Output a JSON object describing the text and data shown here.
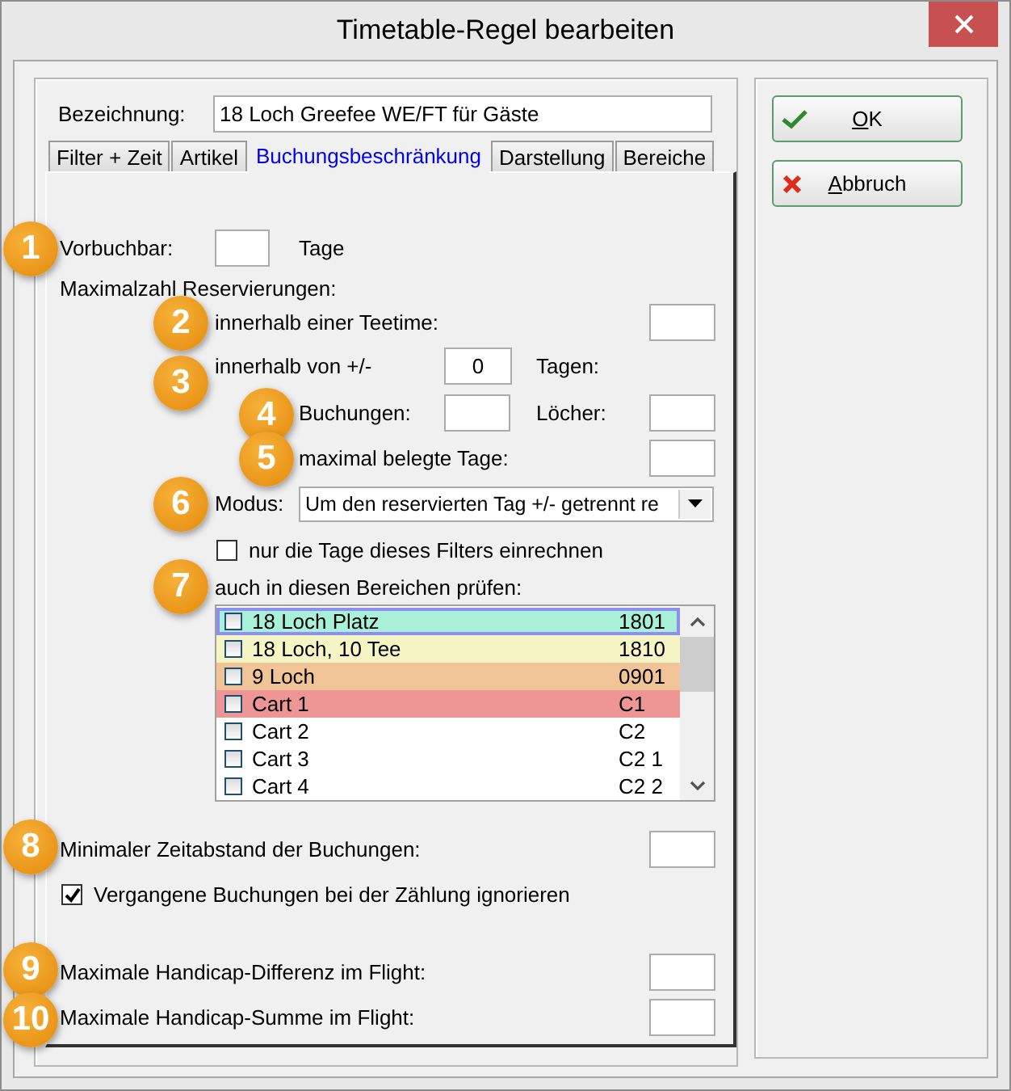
{
  "window": {
    "title": "Timetable-Regel bearbeiten"
  },
  "name_field": {
    "label": "Bezeichnung:",
    "value": "18 Loch Greefee WE/FT für Gäste"
  },
  "tabs": [
    {
      "label": "Filter + Zeit",
      "selected": false
    },
    {
      "label": "Artikel",
      "selected": false
    },
    {
      "label": "Buchungsbeschränkung",
      "selected": true
    },
    {
      "label": "Darstellung",
      "selected": false
    },
    {
      "label": "Bereiche",
      "selected": false
    }
  ],
  "advance_booking": {
    "callout": "1",
    "label": "Vorbuchbar:",
    "unit": "Tage"
  },
  "max_reservations": {
    "heading": "Maximalzahl Reservierungen:",
    "per_teetime": {
      "callout": "2",
      "label": "innerhalb einer Teetime:"
    },
    "range": {
      "callout": "3",
      "label": "innerhalb von +/-",
      "value": "0",
      "unit": "Tagen:"
    },
    "bookings": {
      "callout": "4",
      "label": "Buchungen:",
      "holes_label": "Löcher:"
    },
    "max_days": {
      "callout": "5",
      "label": "maximal belegte Tage:"
    },
    "mode": {
      "callout": "6",
      "label": "Modus:",
      "value": "Um den reservierten Tag +/- getrennt re"
    },
    "filter_days_only": {
      "label": "nur die Tage dieses Filters einrechnen",
      "checked": false
    },
    "areas": {
      "callout": "7",
      "label": "auch in diesen Bereichen prüfen:",
      "items": [
        {
          "name": "18 Loch Platz",
          "code": "1801",
          "checked": false,
          "focused": true,
          "color": "#a8f0d8"
        },
        {
          "name": "18 Loch, 10 Tee",
          "code": "1810",
          "checked": false,
          "focused": false,
          "color": "#f4f4c4"
        },
        {
          "name": "9 Loch",
          "code": "0901",
          "checked": false,
          "focused": false,
          "color": "#f0c496"
        },
        {
          "name": "Cart 1",
          "code": "C1",
          "checked": false,
          "focused": false,
          "color": "#ee9696"
        },
        {
          "name": "Cart 2",
          "code": "C2",
          "checked": false,
          "focused": false,
          "color": "#ffffff"
        },
        {
          "name": "Cart 3",
          "code": "C2 1",
          "checked": false,
          "focused": false,
          "color": "#ffffff"
        },
        {
          "name": "Cart 4",
          "code": "C2 2",
          "checked": false,
          "focused": false,
          "color": "#ffffff"
        }
      ]
    }
  },
  "min_interval": {
    "callout": "8",
    "label": "Minimaler Zeitabstand der Buchungen:"
  },
  "ignore_past": {
    "label": "Vergangene Buchungen bei der Zählung ignorieren",
    "checked": true
  },
  "handicap_difference": {
    "callout": "9",
    "label": "Maximale Handicap-Differenz im Flight:"
  },
  "handicap_sum": {
    "callout": "10",
    "label": "Maximale Handicap-Summe im Flight:"
  },
  "buttons": [
    {
      "kind": "ok",
      "label": "OK"
    },
    {
      "kind": "cancel",
      "label": "Abbruch"
    }
  ]
}
